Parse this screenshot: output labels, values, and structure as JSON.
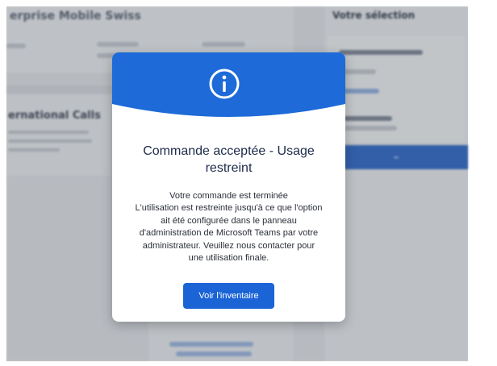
{
  "background": {
    "header_title": "erprise Mobile Swiss",
    "intl_title": "ernational Calls",
    "selection_title": "Votre sélection"
  },
  "modal": {
    "icon": "info-icon",
    "title": "Commande acceptée - Usage restreint",
    "body_lines": [
      "Votre commande est terminée",
      "L'utilisation est restreinte jusqu'à ce que l'option",
      "ait été configurée dans le panneau",
      "d'administration de Microsoft Teams par votre",
      "administrateur. Veuillez nous contacter pour",
      "une utilisation finale."
    ],
    "button_label": "Voir l'inventaire"
  },
  "colors": {
    "accent": "#1a64d6",
    "header_blue": "#1d6ad8",
    "title_navy": "#1c2a4a"
  }
}
